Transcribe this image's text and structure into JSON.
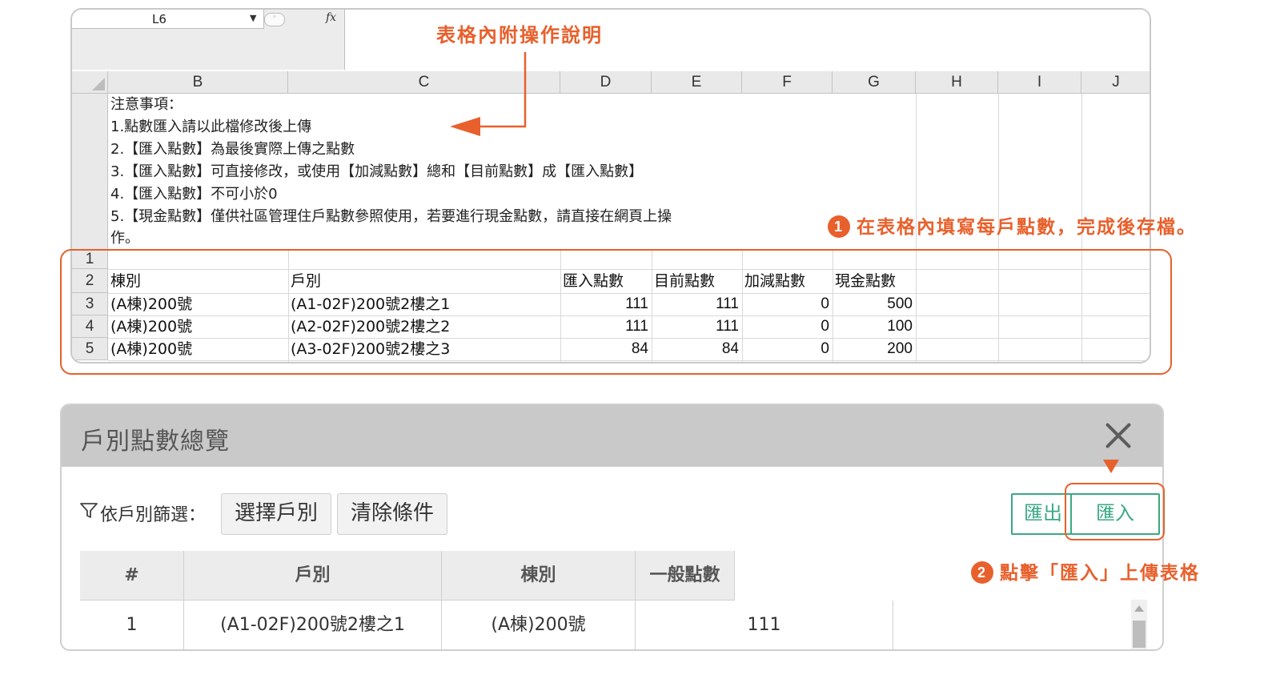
{
  "excel": {
    "name_box": "L6",
    "fx_label": "fx",
    "columns": [
      "B",
      "C",
      "D",
      "E",
      "F",
      "G",
      "H",
      "I",
      "J"
    ],
    "row_numbers": [
      "1",
      "2",
      "3",
      "4",
      "5"
    ],
    "notes": [
      "注意事項：",
      "1.點數匯入請以此檔修改後上傳",
      "2.【匯入點數】為最後實際上傳之點數",
      "3.【匯入點數】可直接修改，或使用【加減點數】總和【目前點數】成【匯入點數】",
      "4.【匯入點數】不可小於0",
      "5.【現金點數】僅供社區管理住戶點數參照使用，若要進行現金點數，請直接在網頁上操",
      "作。"
    ],
    "headers": [
      "棟別",
      "戶別",
      "匯入點數",
      "目前點數",
      "加減點數",
      "現金點數"
    ],
    "rows": [
      [
        "(A棟)200號",
        "(A1-02F)200號2樓之1",
        "111",
        "111",
        "0",
        "500"
      ],
      [
        "(A棟)200號",
        "(A2-02F)200號2樓之2",
        "111",
        "111",
        "0",
        "100"
      ],
      [
        "(A棟)200號",
        "(A3-02F)200號2樓之3",
        "84",
        "84",
        "0",
        "200"
      ]
    ]
  },
  "annotations": {
    "title": "表格內附操作說明",
    "step1_num": "1",
    "step1": "在表格內填寫每戶點數，完成後存檔。",
    "step2_num": "2",
    "step2": "點擊「匯入」上傳表格",
    "accent_color": "#e8602c"
  },
  "dialog": {
    "title": "戶別點數總覽",
    "filter_label": "依戶別篩選：",
    "select_button": "選擇戶別",
    "clear_button": "清除條件",
    "export_button": "匯出",
    "import_button": "匯入",
    "columns": [
      "#",
      "戶別",
      "棟別",
      "一般點數"
    ],
    "rows": [
      [
        "1",
        "(A1-02F)200號2樓之1",
        "(A棟)200號",
        "111"
      ]
    ],
    "accent_color": "#3aa981"
  }
}
